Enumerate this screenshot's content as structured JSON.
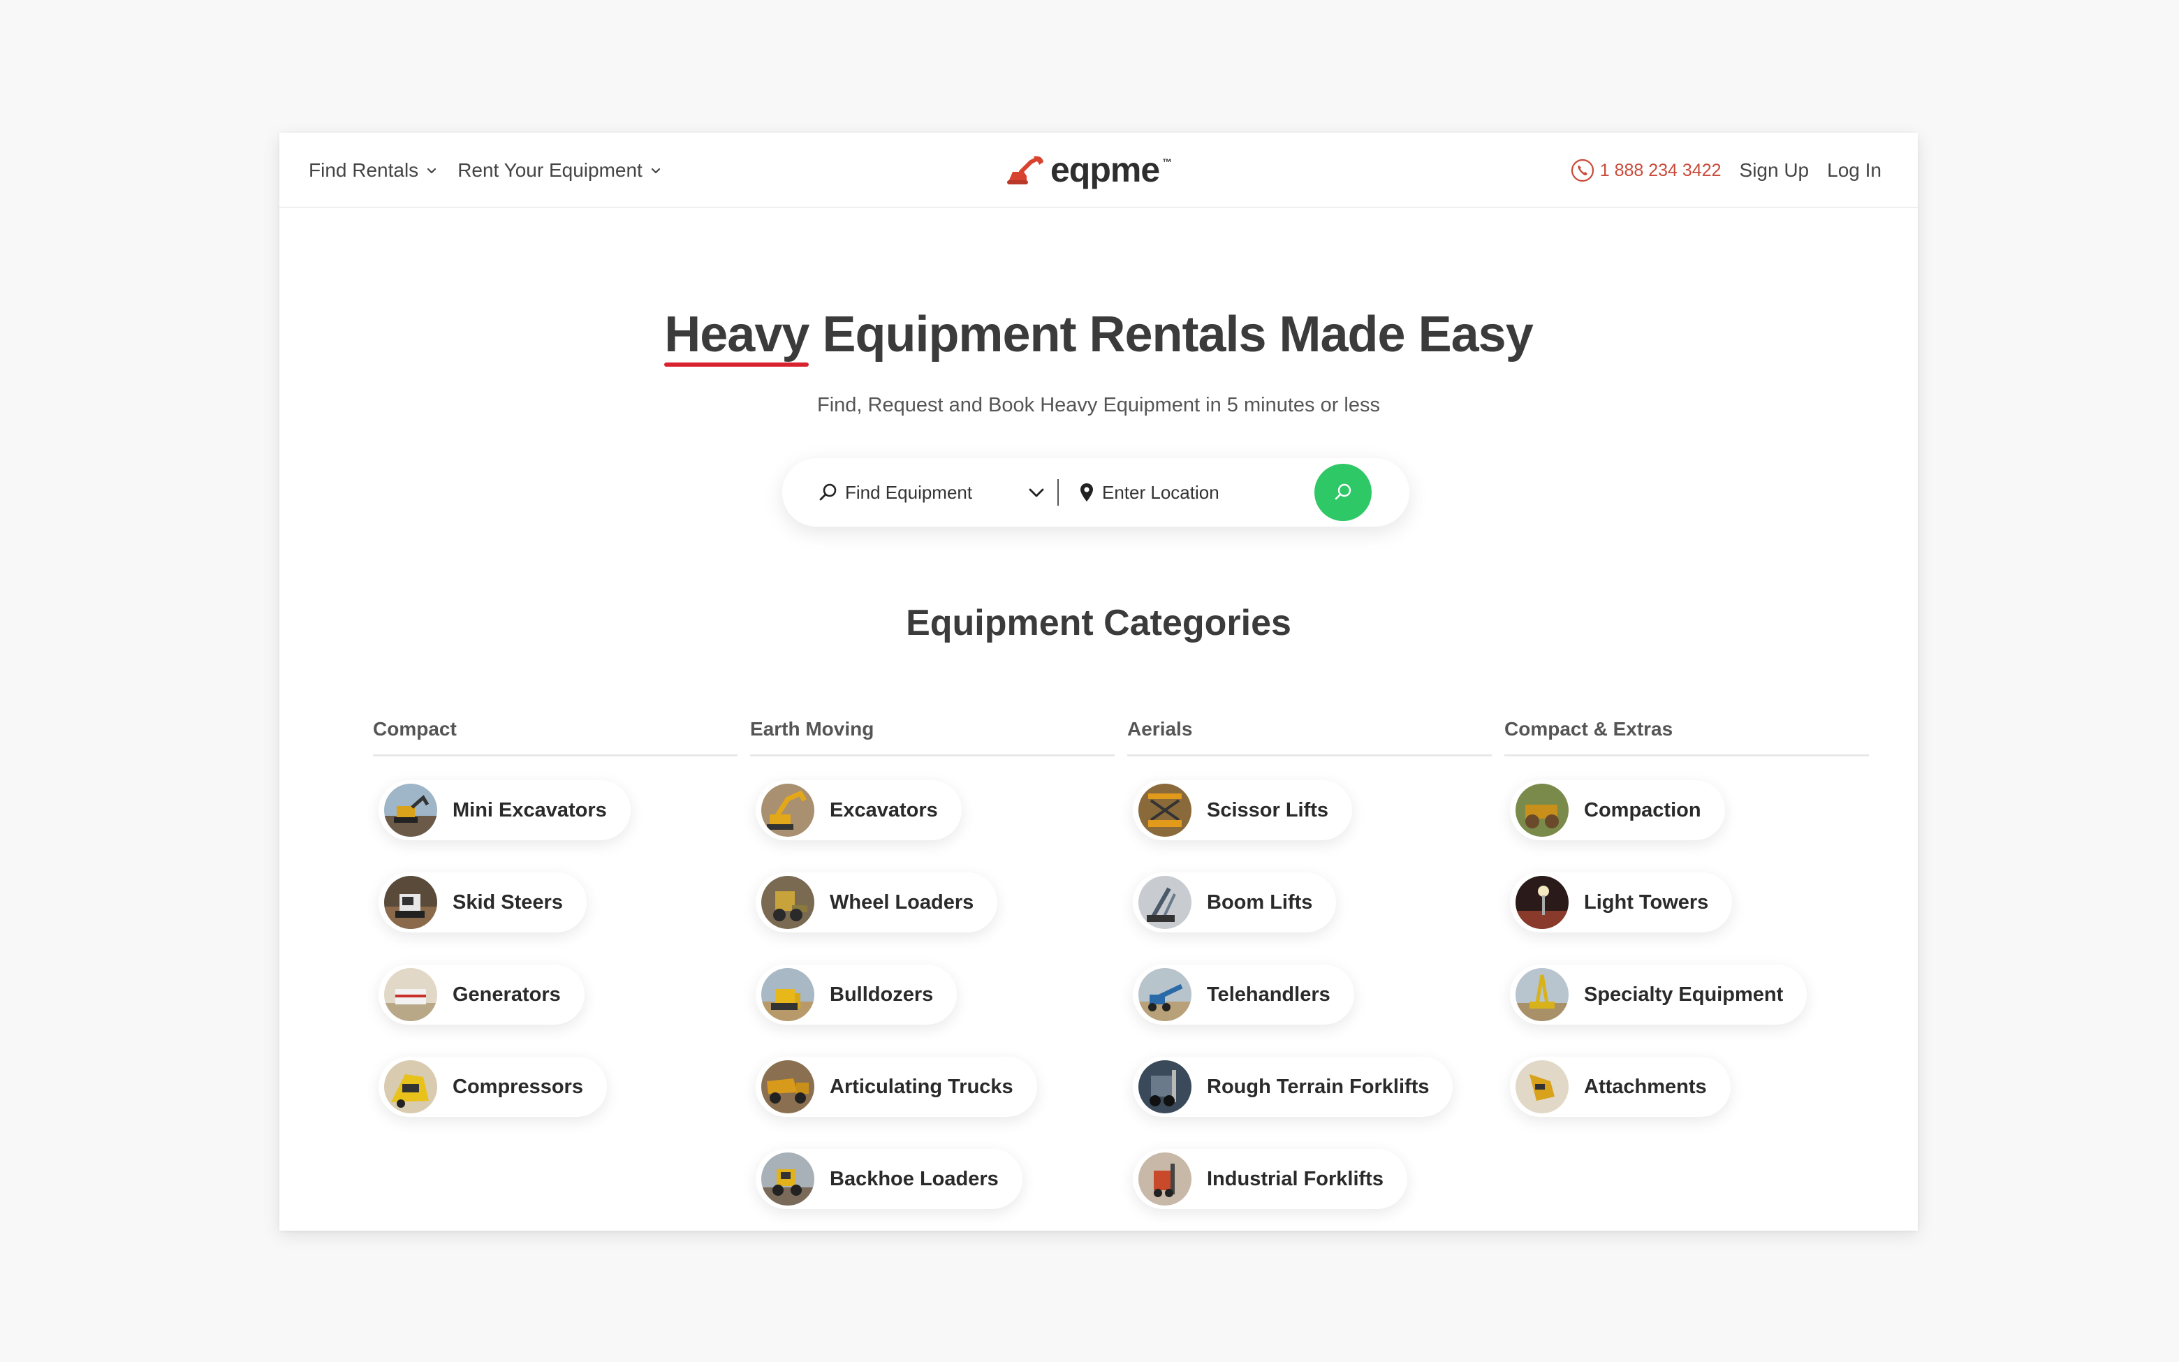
{
  "nav": {
    "find_rentals": "Find Rentals",
    "rent_equipment": "Rent Your Equipment",
    "logo_text": "eqpme",
    "logo_tm": "™",
    "phone": "1 888 234 3422",
    "sign_up": "Sign Up",
    "log_in": "Log In"
  },
  "hero": {
    "title_highlight": "Heavy",
    "title_rest": "Equipment Rentals Made Easy",
    "subtitle": "Find, Request and Book Heavy Equipment in 5 minutes or less"
  },
  "search": {
    "equipment_label": "Find Equipment",
    "location_label": "Enter Location"
  },
  "categories": {
    "title": "Equipment Categories",
    "columns": [
      {
        "heading": "Compact",
        "items": [
          "Mini Excavators",
          "Skid Steers",
          "Generators",
          "Compressors"
        ]
      },
      {
        "heading": "Earth Moving",
        "items": [
          "Excavators",
          "Wheel Loaders",
          "Bulldozers",
          "Articulating Trucks",
          "Backhoe Loaders"
        ]
      },
      {
        "heading": "Aerials",
        "items": [
          "Scissor Lifts",
          "Boom Lifts",
          "Telehandlers",
          "Rough Terrain Forklifts",
          "Industrial Forklifts"
        ]
      },
      {
        "heading": "Compact & Extras",
        "items": [
          "Compaction",
          "Light Towers",
          "Specialty Equipment",
          "Attachments"
        ]
      }
    ]
  },
  "colors": {
    "accent_green": "#2ec866",
    "brand_red": "#d8232f",
    "phone_red": "#c94a3a"
  }
}
